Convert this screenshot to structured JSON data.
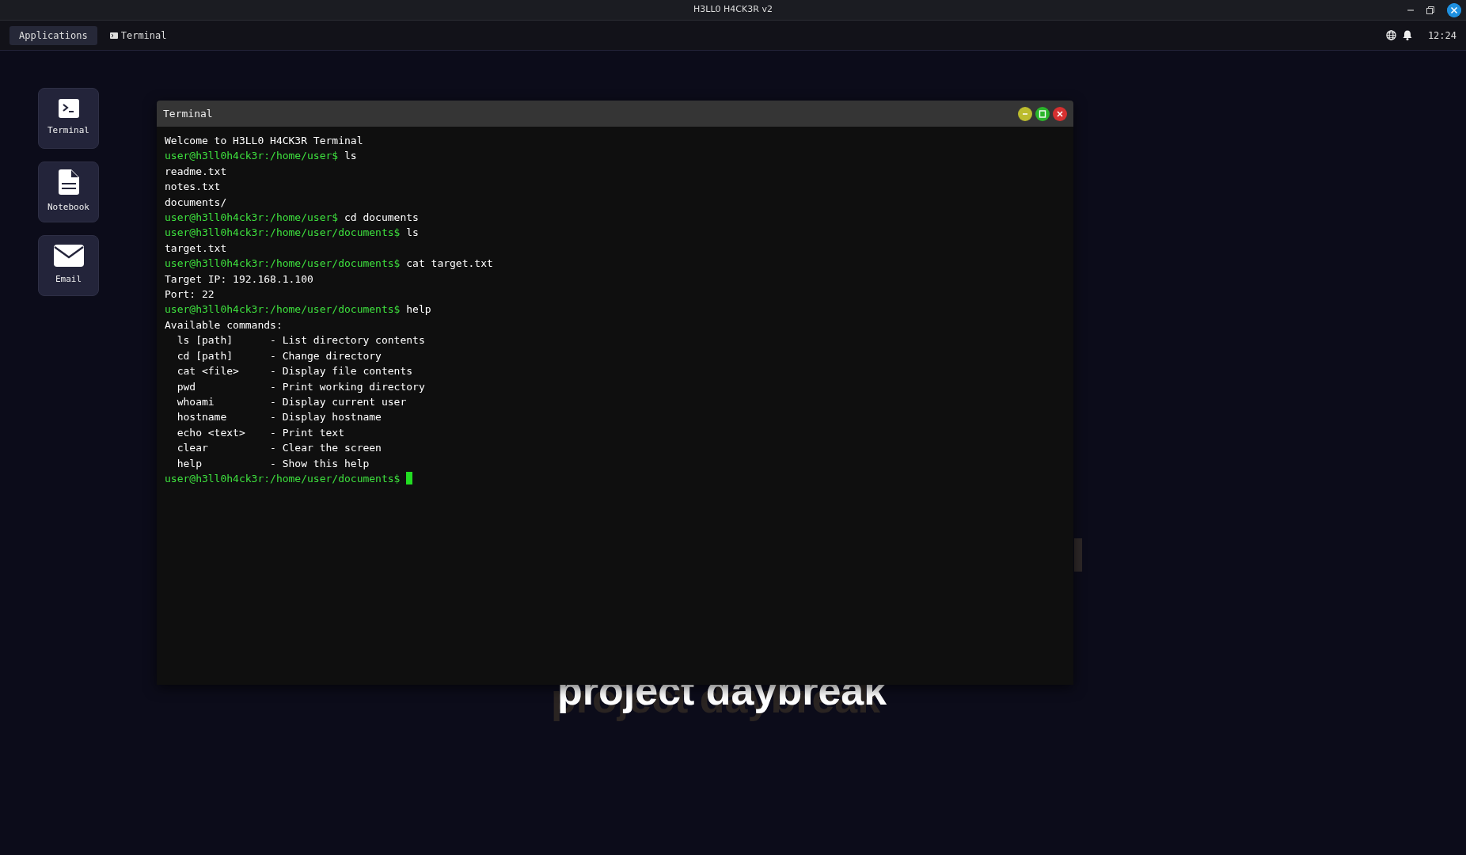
{
  "window": {
    "title": "H3LL0 H4CK3R v2"
  },
  "taskbar": {
    "menu_label": "Applications",
    "tasks": [
      {
        "label": "Terminal",
        "selected": false
      }
    ],
    "clock": "12:24"
  },
  "desktop": {
    "icons": [
      {
        "kind": "terminal",
        "label": "Terminal"
      },
      {
        "kind": "notebook",
        "label": "Notebook"
      },
      {
        "kind": "email",
        "label": "Email"
      }
    ],
    "logo_text": "project daybreak"
  },
  "terminal": {
    "title": "Terminal",
    "lines": [
      {
        "kind": "output",
        "text": "Welcome to H3LL0 H4CK3R Terminal"
      },
      {
        "kind": "prompt",
        "prompt": "user@h3ll0h4ck3r:/home/user$",
        "command": "ls"
      },
      {
        "kind": "output",
        "text": "readme.txt"
      },
      {
        "kind": "output",
        "text": "notes.txt"
      },
      {
        "kind": "output",
        "text": "documents/"
      },
      {
        "kind": "prompt",
        "prompt": "user@h3ll0h4ck3r:/home/user$",
        "command": "cd documents"
      },
      {
        "kind": "prompt",
        "prompt": "user@h3ll0h4ck3r:/home/user/documents$",
        "command": "ls"
      },
      {
        "kind": "output",
        "text": "target.txt"
      },
      {
        "kind": "prompt",
        "prompt": "user@h3ll0h4ck3r:/home/user/documents$",
        "command": "cat target.txt"
      },
      {
        "kind": "output",
        "text": "Target IP: 192.168.1.100"
      },
      {
        "kind": "output",
        "text": "Port: 22"
      },
      {
        "kind": "prompt",
        "prompt": "user@h3ll0h4ck3r:/home/user/documents$",
        "command": "help"
      },
      {
        "kind": "output",
        "text": "Available commands:"
      },
      {
        "kind": "output",
        "text": "  ls [path]      - List directory contents"
      },
      {
        "kind": "output",
        "text": "  cd [path]      - Change directory"
      },
      {
        "kind": "output",
        "text": "  cat <file>     - Display file contents"
      },
      {
        "kind": "output",
        "text": "  pwd            - Print working directory"
      },
      {
        "kind": "output",
        "text": "  whoami         - Display current user"
      },
      {
        "kind": "output",
        "text": "  hostname       - Display hostname"
      },
      {
        "kind": "output",
        "text": "  echo <text>    - Print text"
      },
      {
        "kind": "output",
        "text": "  clear          - Clear the screen"
      },
      {
        "kind": "output",
        "text": "  help           - Show this help"
      },
      {
        "kind": "prompt",
        "prompt": "user@h3ll0h4ck3r:/home/user/documents$",
        "cursor": true
      }
    ]
  }
}
